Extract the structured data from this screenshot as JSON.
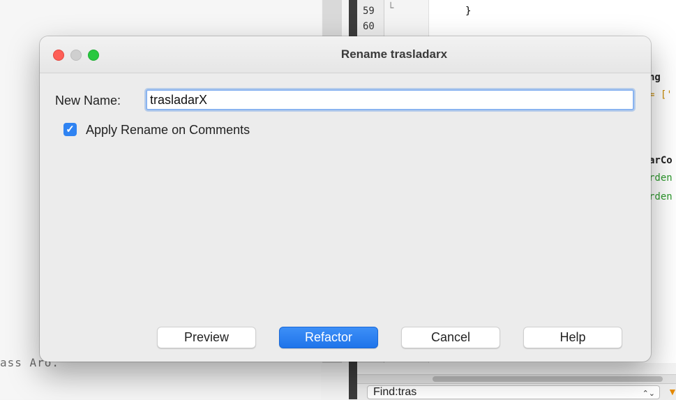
{
  "background": {
    "left_code": "ass Aro.",
    "line_numbers": [
      "59",
      "60"
    ],
    "fold_marker": "└",
    "editor_lines": [
      "}"
    ],
    "right_fragments": [
      {
        "text": "ng",
        "color": "#222222"
      },
      {
        "text": "= ['",
        "color": "#c88a00"
      },
      {
        "text": "arCo",
        "color": "#222222"
      },
      {
        "text": "rden",
        "color": "#2c9a2c"
      },
      {
        "text": "rden",
        "color": "#2c9a2c"
      }
    ],
    "find_bar": {
      "value": "Find:tras",
      "stepper_icon": "updown-chevron-icon"
    }
  },
  "dialog": {
    "title": "Rename trasladarx",
    "new_name_label": "New Name:",
    "new_name_value": "trasladarX",
    "apply_comments_label": "Apply Rename on Comments",
    "apply_comments_checked": true,
    "buttons": {
      "preview": "Preview",
      "refactor": "Refactor",
      "cancel": "Cancel",
      "help": "Help"
    }
  },
  "colors": {
    "accent": "#2f83f2",
    "close": "#fe5f57",
    "zoom": "#28c840"
  }
}
